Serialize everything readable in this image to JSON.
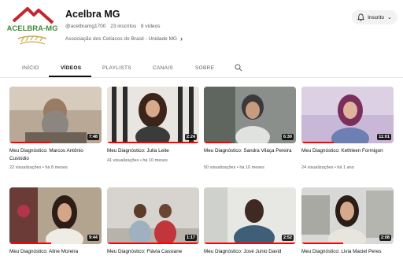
{
  "channel": {
    "name": "Acelbra MG",
    "handle": "@acelbramg1700",
    "subscribers": "23 inscritos",
    "videos_count": "8 vídeos",
    "description": "Associação dos Celíacos do Brasil - Unidade MG",
    "logo_text": "ACELBRA-MG",
    "subscribe_label": "Inscrito"
  },
  "tabs": [
    "INÍCIO",
    "VÍDEOS",
    "PLAYLISTS",
    "CANAIS",
    "SOBRE"
  ],
  "active_tab": "VÍDEOS",
  "icons": {
    "search": "search-icon",
    "bell": "bell-icon",
    "chevron": "chevron-right-icon",
    "caret": "chevron-down-icon"
  },
  "colors": {
    "progress": "#ff0000",
    "brand_red": "#c4262e",
    "brand_green": "#3f8a3a"
  },
  "videos": [
    {
      "title": "Meu Diagnóstico: Marcos Antônio Custódio",
      "views": "22 visualizações",
      "age": "há 8 meses",
      "duration": "7:48",
      "watched": 0.45
    },
    {
      "title": "Meu Diagnóstico: Julia Leite",
      "views": "41 visualizações",
      "age": "há 10 meses",
      "duration": "2:24",
      "watched": 1.0
    },
    {
      "title": "Meu Diagnóstico: Sandra Vilaça Pereira",
      "views": "50 visualizações",
      "age": "há 10 meses",
      "duration": "6:30",
      "watched": 0.3
    },
    {
      "title": "Meu Diagnóstico: Kethleen Formigon",
      "views": "24 visualizações",
      "age": "há 1 ano",
      "duration": "11:01",
      "watched": 0.35
    },
    {
      "title": "Meu Diagnóstico: Aline Moreira",
      "views": "",
      "age": "",
      "duration": "9:44",
      "watched": 0.45
    },
    {
      "title": "Meu Diagnóstico: Flávia Cassiane",
      "views": "",
      "age": "",
      "duration": "1:17",
      "watched": 1.0
    },
    {
      "title": "Meu Diagnóstico: José Junio David",
      "views": "",
      "age": "",
      "duration": "2:52",
      "watched": 1.0
    },
    {
      "title": "Meu Diagnóstico: Livia Maciel Peres",
      "views": "",
      "age": "",
      "duration": "2:08",
      "watched": 0.45
    }
  ]
}
